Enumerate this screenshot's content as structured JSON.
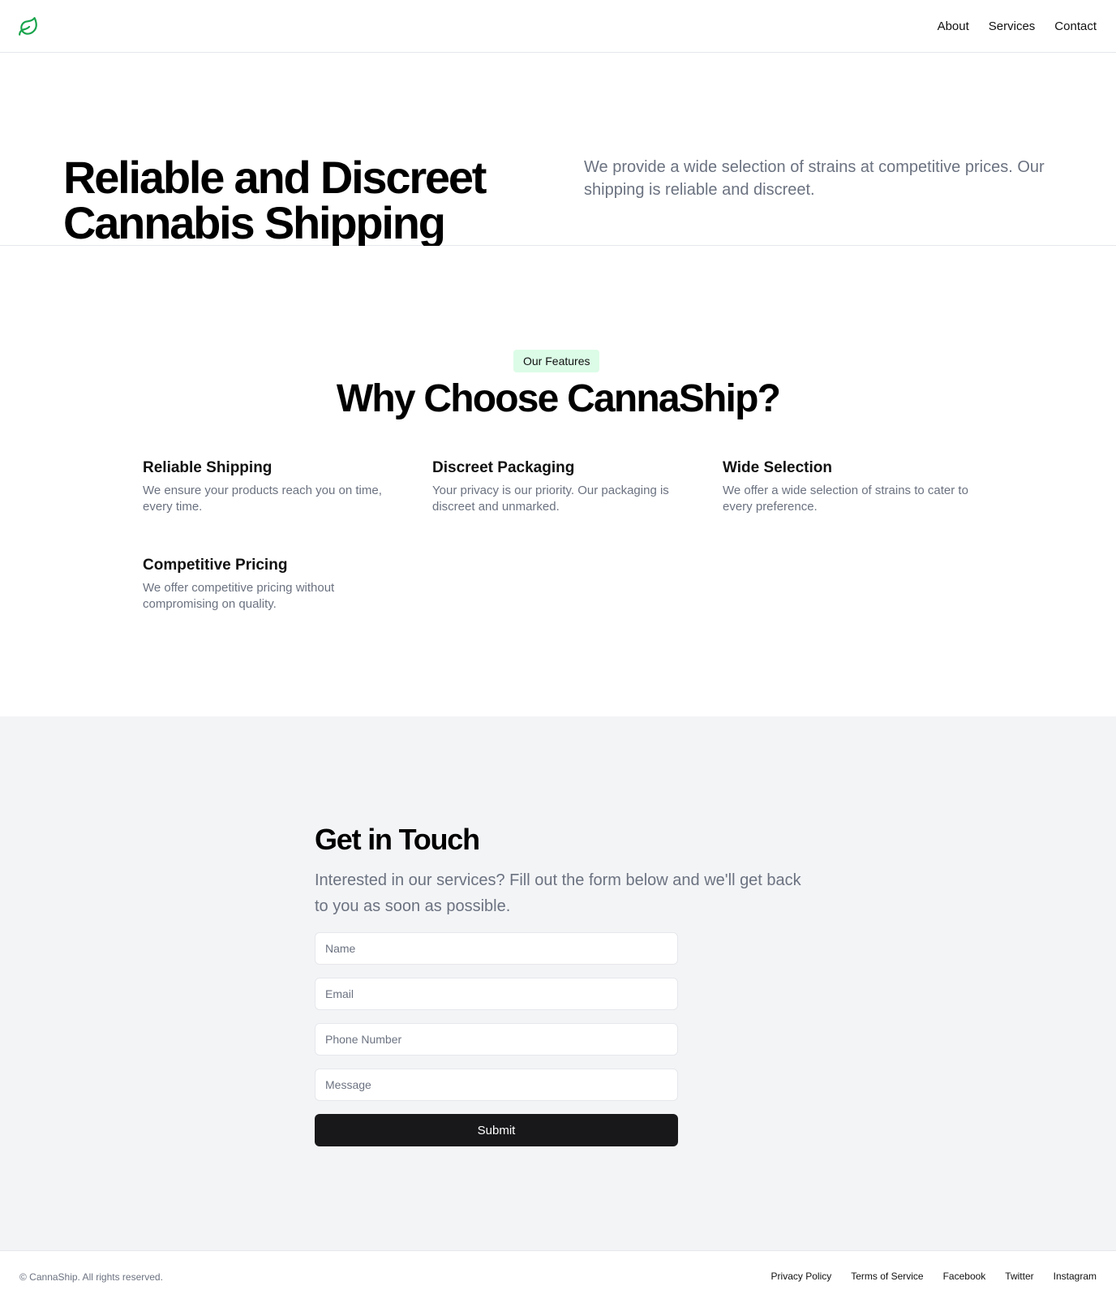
{
  "header": {
    "logo_icon": "leaf-icon",
    "brand_color": "#16a34a",
    "nav": [
      {
        "label": "About"
      },
      {
        "label": "Services"
      },
      {
        "label": "Contact"
      }
    ]
  },
  "hero": {
    "title": "Reliable and Discreet Cannabis Shipping",
    "subtitle": "We provide a wide selection of strains at competitive prices. Our shipping is reliable and discreet."
  },
  "features": {
    "badge": "Our Features",
    "badge_color": "#dcfce7",
    "title": "Why Choose CannaShip?",
    "items": [
      {
        "title": "Reliable Shipping",
        "description": "We ensure your products reach you on time, every time."
      },
      {
        "title": "Discreet Packaging",
        "description": "Your privacy is our priority. Our packaging is discreet and unmarked."
      },
      {
        "title": "Wide Selection",
        "description": "We offer a wide selection of strains to cater to every preference."
      },
      {
        "title": "Competitive Pricing",
        "description": "We offer competitive pricing without compromising on quality."
      }
    ]
  },
  "contact": {
    "title": "Get in Touch",
    "subtitle": "Interested in our services? Fill out the form below and we'll get back to you as soon as possible.",
    "fields": {
      "name_placeholder": "Name",
      "email_placeholder": "Email",
      "phone_placeholder": "Phone Number",
      "message_placeholder": "Message"
    },
    "submit_label": "Submit"
  },
  "footer": {
    "copyright": "© CannaShip. All rights reserved.",
    "links": [
      {
        "label": "Privacy Policy"
      },
      {
        "label": "Terms of Service"
      },
      {
        "label": "Facebook"
      },
      {
        "label": "Twitter"
      },
      {
        "label": "Instagram"
      }
    ]
  }
}
